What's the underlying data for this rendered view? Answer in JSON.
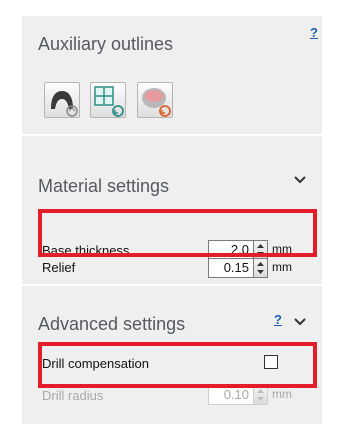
{
  "auxiliary": {
    "title": "Auxiliary outlines",
    "help": "?",
    "tools": [
      {
        "icon": "jaw-outline-icon"
      },
      {
        "icon": "grid-outline-icon"
      },
      {
        "icon": "disc-outline-icon"
      }
    ]
  },
  "material": {
    "title": "Material settings",
    "base_thickness": {
      "label": "Base thickness",
      "value": "2.0",
      "unit": "mm"
    },
    "relief": {
      "label": "Relief",
      "value": "0.15",
      "unit": "mm"
    }
  },
  "advanced": {
    "title": "Advanced settings",
    "help": "?",
    "drill_compensation": {
      "label": "Drill compensation",
      "checked": false
    },
    "drill_radius": {
      "label": "Drill radius",
      "value": "0.10",
      "unit": "mm"
    }
  },
  "colors": {
    "highlight": "#e31e2a",
    "panel": "#efefef",
    "help_link": "#1f5fb4"
  }
}
